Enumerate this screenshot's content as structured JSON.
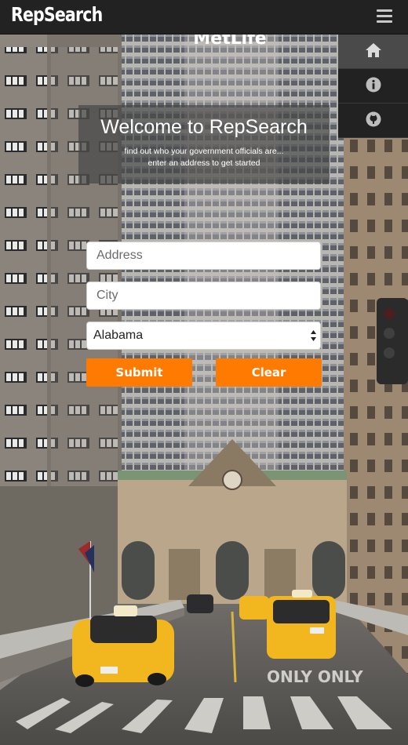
{
  "navbar": {
    "brand": "RepSearch",
    "menu_icon": "hamburger-menu-icon"
  },
  "sidenav": {
    "items": [
      {
        "icon": "home-icon",
        "active": true
      },
      {
        "icon": "info-icon",
        "active": false
      },
      {
        "icon": "github-icon",
        "active": false
      }
    ]
  },
  "banner": {
    "title": "Welcome to RepSearch",
    "subtitle_line1": "find out who your government officials are...",
    "subtitle_line2": "enter an address to get started"
  },
  "form": {
    "address_placeholder": "Address",
    "city_placeholder": "City",
    "state_selected": "Alabama",
    "submit_label": "Submit",
    "clear_label": "Clear"
  },
  "background": {
    "building_sign": "MetLife"
  },
  "colors": {
    "navbar": "#222222",
    "accent": "#ff7a00",
    "banner_overlay": "rgba(70,70,70,0.68)"
  }
}
